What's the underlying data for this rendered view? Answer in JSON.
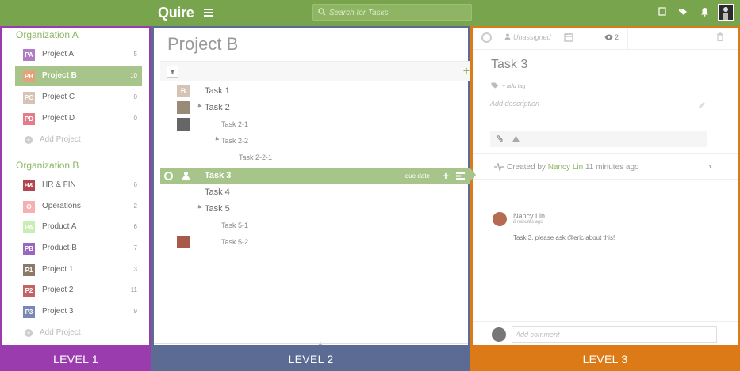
{
  "topbar": {
    "logo": "Quire",
    "search_placeholder": "Search for Tasks",
    "accent": "#77a44d"
  },
  "level_labels": [
    "LEVEL 1",
    "LEVEL 2",
    "LEVEL 3"
  ],
  "level_colors": [
    "#9a3cae",
    "#5c6b94",
    "#db7a16"
  ],
  "sidebar": {
    "orgs": [
      {
        "name": "Organization A",
        "projects": [
          {
            "badge": "PA",
            "name": "Project A",
            "count": "5",
            "color": "#b07cc6"
          },
          {
            "badge": "PB",
            "name": "Project B",
            "count": "10",
            "color": "#e0a37c",
            "active": true
          },
          {
            "badge": "PC",
            "name": "Project C",
            "count": "0",
            "color": "#d6c3b5"
          },
          {
            "badge": "PD",
            "name": "Project D",
            "count": "0",
            "color": "#e57c8a"
          }
        ],
        "add_label": "Add Project"
      },
      {
        "name": "Organization B",
        "projects": [
          {
            "badge": "H&",
            "name": "HR & FIN",
            "count": "6",
            "color": "#b2454f"
          },
          {
            "badge": "O",
            "name": "Operations",
            "count": "2",
            "color": "#f5b1b1"
          },
          {
            "badge": "PA",
            "name": "Product A",
            "count": "6",
            "color": "#c8eeb4"
          },
          {
            "badge": "PB",
            "name": "Product B",
            "count": "7",
            "color": "#9a67c0"
          },
          {
            "badge": "P1",
            "name": "Project 1",
            "count": "3",
            "color": "#8a7a6a"
          },
          {
            "badge": "P2",
            "name": "Project 2",
            "count": "11",
            "color": "#c46363"
          },
          {
            "badge": "P3",
            "name": "Project 3",
            "count": "9",
            "color": "#7a88b4"
          }
        ],
        "add_label": "Add Project"
      }
    ]
  },
  "project": {
    "title": "Project B",
    "tasks": [
      {
        "name": "Task 1",
        "indent": 0,
        "badge": "B"
      },
      {
        "name": "Task 2",
        "indent": 0,
        "expanded": true,
        "avatar": true
      },
      {
        "name": "Task 2-1",
        "indent": 1,
        "avatar": true
      },
      {
        "name": "Task 2-2",
        "indent": 1,
        "expanded": true
      },
      {
        "name": "Task 2-2-1",
        "indent": 2
      },
      {
        "name": "Task 3",
        "indent": 0,
        "active": true
      },
      {
        "name": "Task 4",
        "indent": 0
      },
      {
        "name": "Task 5",
        "indent": 0,
        "expanded": true
      },
      {
        "name": "Task 5-1",
        "indent": 1
      },
      {
        "name": "Task 5-2",
        "indent": 1,
        "avatar": true
      }
    ],
    "active_task_due": "due date"
  },
  "detail": {
    "assignee": "Unassigned",
    "watchers": "2",
    "title": "Task 3",
    "add_tag": "+ add tag",
    "description_placeholder": "Add description",
    "activity": {
      "prefix": "Created by",
      "who": "Nancy Lin",
      "when": "11 minutes ago"
    },
    "comment": {
      "author": "Nancy Lin",
      "time": "8 minutes ago",
      "text": "Task 3, please ask @eric about this!"
    },
    "add_comment_placeholder": "Add comment"
  }
}
